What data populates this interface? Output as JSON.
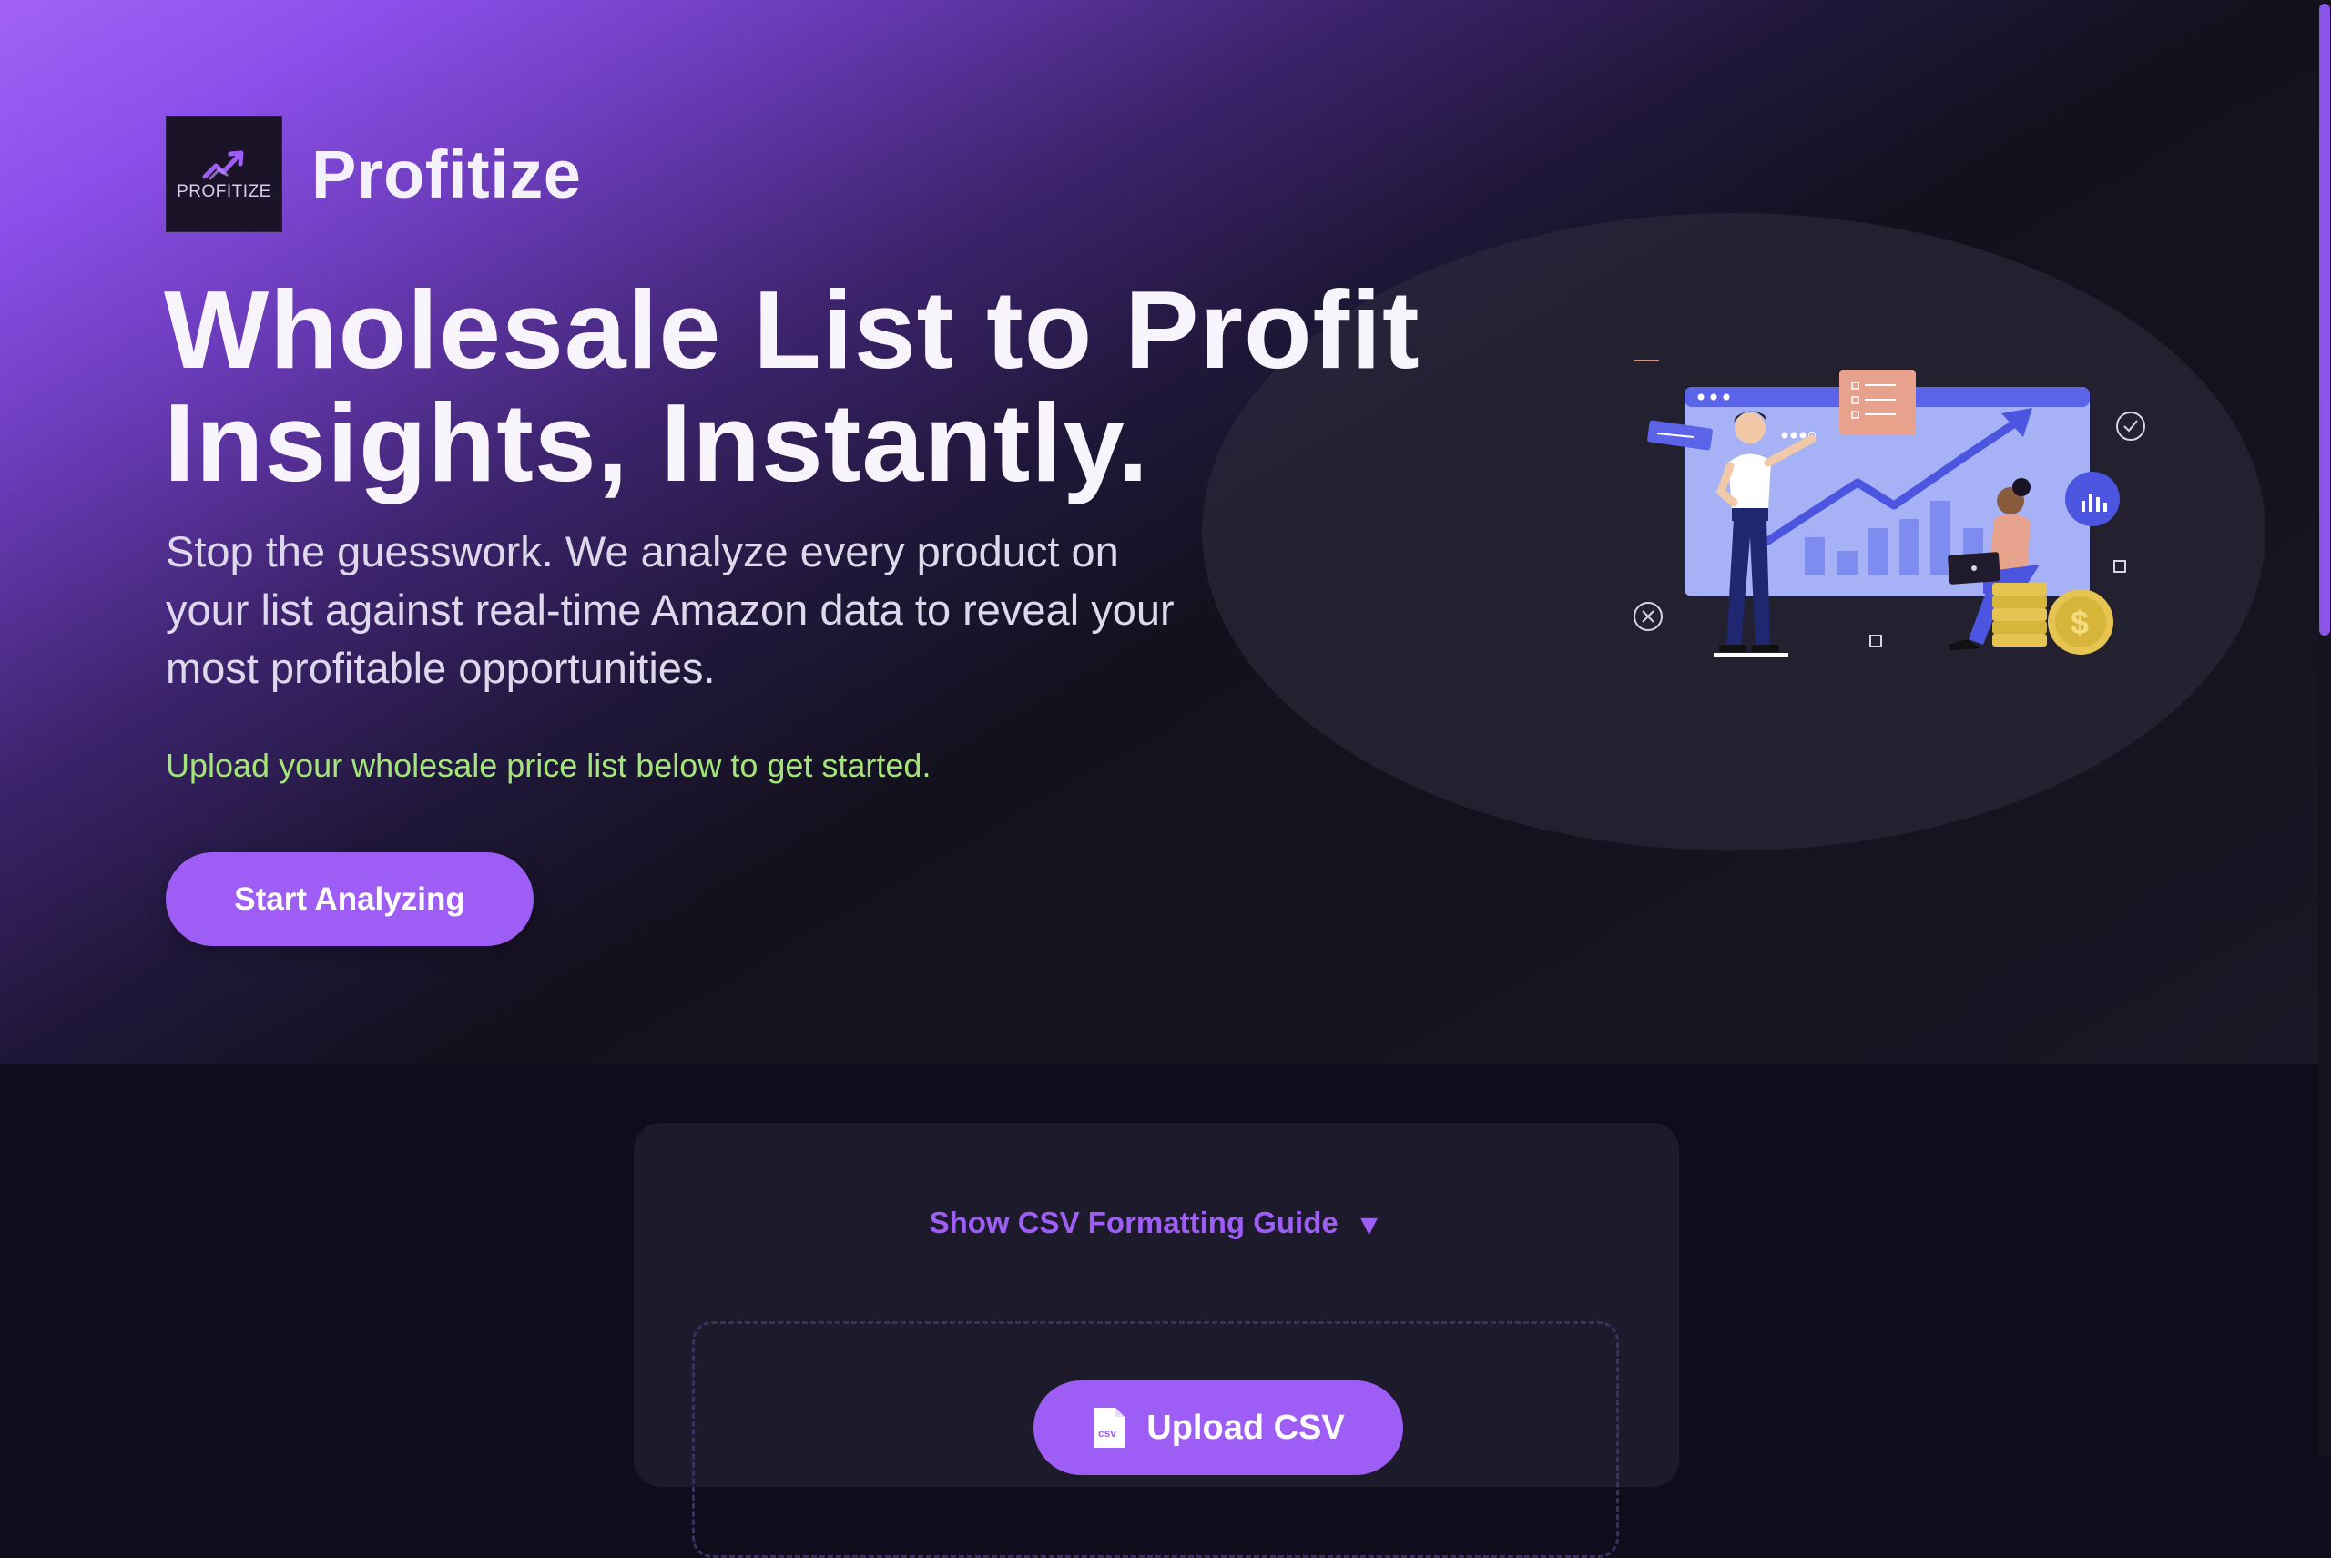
{
  "brand": {
    "logo_text": "PROFITIZE",
    "name": "Profitize"
  },
  "hero": {
    "headline_line1": "Wholesale List to Profit",
    "headline_line2": "Insights, Instantly.",
    "subtext": "Stop the guesswork. We analyze every product on your list against real-time Amazon data to reveal your most profitable opportunities.",
    "upload_hint": "Upload your wholesale price list below to get started.",
    "cta_label": "Start Analyzing"
  },
  "upload": {
    "guide_toggle_label": "Show CSV Formatting Guide",
    "guide_toggle_icon": "▼",
    "upload_button_label": "Upload CSV",
    "file_icon_text": "csv"
  },
  "colors": {
    "accent": "#9e5ef5",
    "hint_green": "#a4e57a",
    "background": "#0f0d1c",
    "card": "#1d1b2b"
  }
}
